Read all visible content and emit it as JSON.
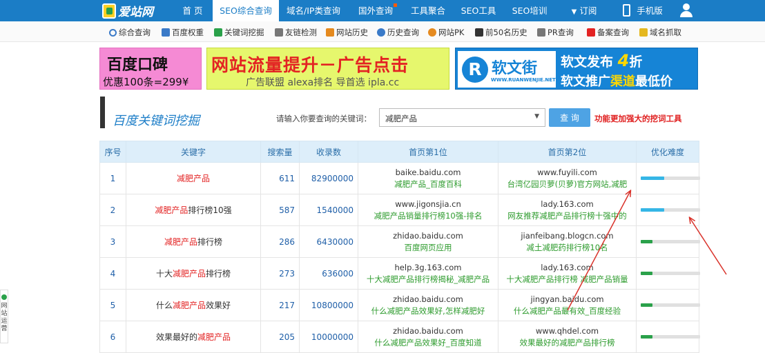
{
  "header": {
    "logo_text": "爱站网",
    "nav": [
      {
        "label": "首 页"
      },
      {
        "label": "SEO综合查询"
      },
      {
        "label": "域名/IP类查询"
      },
      {
        "label": "国外查询"
      },
      {
        "label": "工具聚合"
      },
      {
        "label": "SEO工具"
      },
      {
        "label": "SEO培训"
      },
      {
        "label": "订阅"
      },
      {
        "label": "手机版"
      }
    ],
    "active_nav": "SEO综合查询"
  },
  "subnav": [
    {
      "label": "综合查询",
      "icon": "search-icon",
      "color": "#3a7ac8"
    },
    {
      "label": "百度权重",
      "icon": "home-icon",
      "color": "#3a7ac8"
    },
    {
      "label": "关键词挖掘",
      "icon": "rocket-icon",
      "color": "#2aa14a"
    },
    {
      "label": "友链检测",
      "icon": "link-icon",
      "color": "#777777"
    },
    {
      "label": "网站历史",
      "icon": "chart-icon",
      "color": "#e58a1f"
    },
    {
      "label": "历史查询",
      "icon": "clock-icon",
      "color": "#3a7ac8"
    },
    {
      "label": "网站PK",
      "icon": "globe-icon",
      "color": "#e58a1f"
    },
    {
      "label": "前50名历史",
      "icon": "bars-icon",
      "color": "#333333"
    },
    {
      "label": "PR查询",
      "icon": "shield-icon",
      "color": "#777777"
    },
    {
      "label": "备案查询",
      "icon": "flag-icon",
      "color": "#e32323"
    },
    {
      "label": "域名抓取",
      "icon": "warning-icon",
      "color": "#e5b81f"
    }
  ],
  "banners": {
    "b1": {
      "big": "百度口碑",
      "small": "优惠100条=299¥"
    },
    "b2": {
      "big": "网站流量提升－广告点击",
      "small": "广告联盟 alexa排名 导首选 ipla.cc"
    },
    "b3": {
      "logo": "R",
      "name": "软文街",
      "url": "WWW.RUANWENJIE.NET",
      "line1": "软文发布",
      "num": "4",
      "unit": "折",
      "line2_a": "软文推广",
      "line2_hl": "渠道",
      "line2_b": "最低价"
    }
  },
  "tool": {
    "title": "百度关键词挖掘",
    "prompt": "请输入你要查询的关键词：",
    "keyword": "减肥产品",
    "query_label": "查 询",
    "promo": "功能更加强大的挖词工具"
  },
  "table": {
    "headers": [
      "序号",
      "关键字",
      "搜索量",
      "收录数",
      "首页第1位",
      "首页第2位",
      "优化难度"
    ],
    "rows": [
      {
        "idx": "1",
        "kw_pre": "",
        "kw_hl": "减肥产品",
        "kw_post": "",
        "search": "611",
        "indexed": "82900000",
        "p1_domain": "baike.baidu.com",
        "p1_title": "减肥产品_百度百科",
        "p2_domain": "www.fuyili.com",
        "p2_title": "台湾亿园贝萝(贝萝)官方网站,减肥",
        "difficulty": 0.4,
        "bar_color": "#35b6e6"
      },
      {
        "idx": "2",
        "kw_pre": "",
        "kw_hl": "减肥产品",
        "kw_post": "排行榜10强",
        "search": "587",
        "indexed": "1540000",
        "p1_domain": "www.jigonsjia.cn",
        "p1_title": "减肥产品销量排行榜10强-排名",
        "p2_domain": "lady.163.com",
        "p2_title": "网友推荐减肥产品排行榜十强中的",
        "difficulty": 0.4,
        "bar_color": "#35b6e6"
      },
      {
        "idx": "3",
        "kw_pre": "",
        "kw_hl": "减肥产品",
        "kw_post": "排行榜",
        "search": "286",
        "indexed": "6430000",
        "p1_domain": "zhidao.baidu.com",
        "p1_title": "百度网页应用",
        "p2_domain": "jianfeibang.blogcn.com",
        "p2_title": "减土减肥药排行榜10名",
        "difficulty": 0.2,
        "bar_color": "#2aa14a"
      },
      {
        "idx": "4",
        "kw_pre": "十大",
        "kw_hl": "减肥产品",
        "kw_post": "排行榜",
        "search": "273",
        "indexed": "636000",
        "p1_domain": "help.3g.163.com",
        "p1_title": "十大减肥产品排行榜揭秘_减肥产品",
        "p2_domain": "lady.163.com",
        "p2_title": "十大减肥产品排行榜 减肥产品销量",
        "difficulty": 0.2,
        "bar_color": "#2aa14a"
      },
      {
        "idx": "5",
        "kw_pre": "什么",
        "kw_hl": "减肥产品",
        "kw_post": "效果好",
        "search": "217",
        "indexed": "10800000",
        "p1_domain": "zhidao.baidu.com",
        "p1_title": "什么减肥产品效果好,怎样减肥好",
        "p2_domain": "jingyan.baidu.com",
        "p2_title": "什么减肥产品最有效_百度经验",
        "difficulty": 0.2,
        "bar_color": "#2aa14a"
      },
      {
        "idx": "6",
        "kw_pre": "效果最好的",
        "kw_hl": "减肥产品",
        "kw_post": "",
        "search": "205",
        "indexed": "10000000",
        "p1_domain": "zhidao.baidu.com",
        "p1_title": "什么减肥产品效果好_百度知道",
        "p2_domain": "www.qhdel.com",
        "p2_title": "效果最好的减肥产品排行榜",
        "difficulty": 0.2,
        "bar_color": "#2aa14a"
      }
    ]
  },
  "side_tab": {
    "label": "网站运营"
  }
}
